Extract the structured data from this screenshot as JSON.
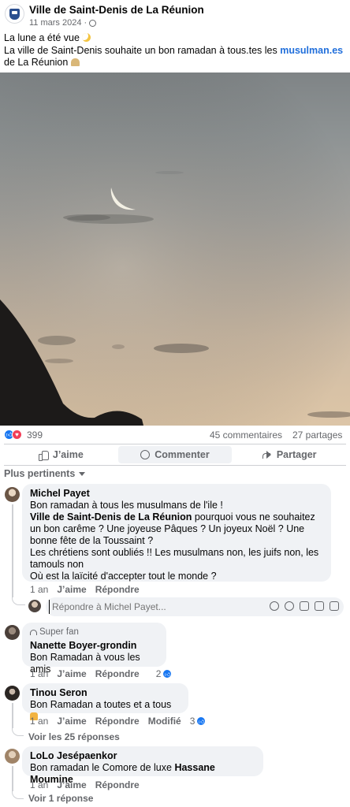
{
  "post": {
    "page_name": "Ville de Saint-Denis de La Réunion",
    "date": "11 mars 2024",
    "separator": "·",
    "more": "···",
    "line1": "La lune a été vue",
    "line2_pre": "La ville de Saint-Denis souhaite un bon ramadan à tous.tes les ",
    "line2_link": "musulman.es",
    "line3": "de La Réunion"
  },
  "stats": {
    "reactions": "399",
    "comments": "45 commentaires",
    "shares": "27 partages"
  },
  "actions": {
    "like": "J’aime",
    "comment": "Commenter",
    "share": "Partager"
  },
  "sort_label": "Plus pertinents",
  "comments": [
    {
      "author": "Michel Payet",
      "lines": [
        "Bon ramadan à tous les musulmans de l'ile !",
        "pourquoi vous ne souhaitez un bon carême ? Une joyeuse Pâques ? Un joyeux Noël ? Une bonne fête de la Toussaint ?",
        "Les chrétiens sont oubliés !! Les musulmans non, les juifs non, les tamouls non",
        "Où est la laïcité d'accepter tout le monde ?"
      ],
      "mention": "Ville de Saint-Denis de La Réunion",
      "time": "1 an",
      "like": "J’aime",
      "reply": "Répondre",
      "reply_placeholder": "Répondre à Michel Payet..."
    },
    {
      "badge": "Super fan",
      "author": "Nanette Boyer-grondin",
      "text": "Bon Ramadan à vous les amis",
      "time": "1 an",
      "like": "J’aime",
      "reply": "Répondre",
      "reactions": "2"
    },
    {
      "author": "Tinou Seron",
      "text": "Bon Ramadan a toutes et a tous",
      "time": "1 an",
      "like": "J’aime",
      "reply": "Répondre",
      "edited": "Modifié",
      "reactions": "3",
      "see_replies": "Voir les 25 réponses"
    },
    {
      "author": "LoLo Jesépaenkor",
      "text": "Bon ramadan le Comore de luxe ",
      "mention": "Hassane Moumine",
      "time": "1 an",
      "like": "J’aime",
      "reply": "Répondre",
      "see_replies": "Voir 1 réponse"
    }
  ],
  "colors": {
    "link": "#216fdb",
    "like_blue": "#1877f2",
    "love_red": "#f33e58",
    "secondary_text": "#65676b",
    "bubble_bg": "#f0f2f5"
  },
  "icons": [
    "globe-icon",
    "like-icon",
    "love-icon",
    "comment-icon",
    "share-icon",
    "chevron-down-icon",
    "moon-emoji",
    "mosque-emoji",
    "pray-emoji",
    "superfan-icon"
  ]
}
